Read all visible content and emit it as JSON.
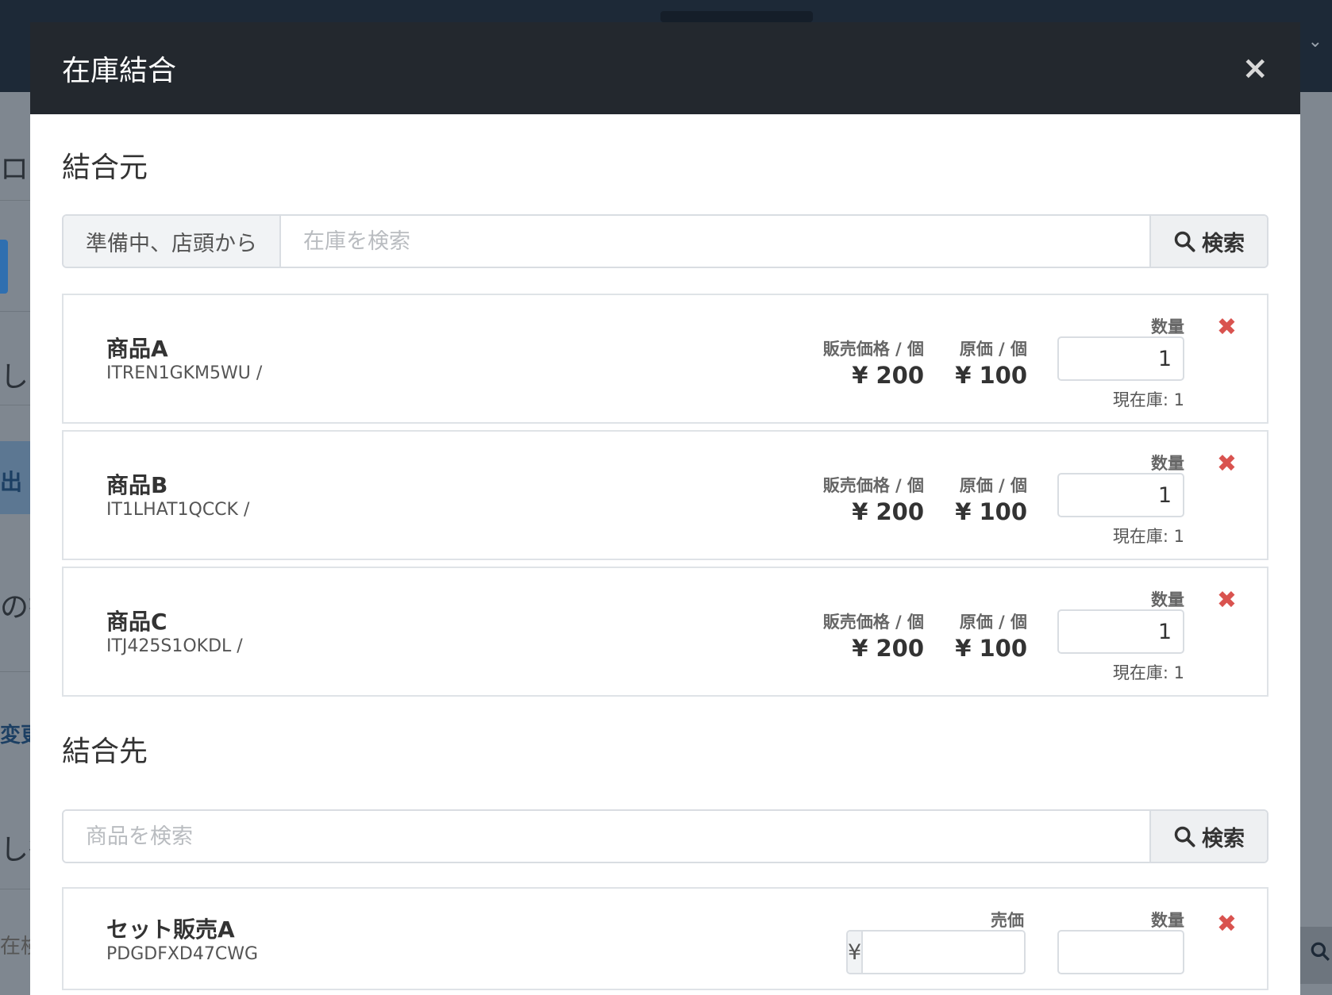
{
  "background": {
    "side_fragments": [
      "ログ",
      "し開",
      "出",
      "の操",
      "変更",
      "し待",
      "在検"
    ],
    "right_icon": "search-icon"
  },
  "modal": {
    "title": "在庫結合",
    "close_glyph": "×"
  },
  "source": {
    "section_title": "結合元",
    "filter_label": "準備中、店頭から",
    "search_placeholder": "在庫を検索",
    "search_button": "検索",
    "items": [
      {
        "name": "商品A",
        "code": "ITREN1GKM5WU /",
        "sale_label": "販売価格 / 個",
        "sale_price": "¥ 200",
        "cost_label": "原価 / 個",
        "cost_price": "¥ 100",
        "qty_label": "数量",
        "qty": "1",
        "stock": "現在庫: 1"
      },
      {
        "name": "商品B",
        "code": "IT1LHAT1QCCK /",
        "sale_label": "販売価格 / 個",
        "sale_price": "¥ 200",
        "cost_label": "原価 / 個",
        "cost_price": "¥ 100",
        "qty_label": "数量",
        "qty": "1",
        "stock": "現在庫: 1"
      },
      {
        "name": "商品C",
        "code": "ITJ425S1OKDL /",
        "sale_label": "販売価格 / 個",
        "sale_price": "¥ 200",
        "cost_label": "原価 / 個",
        "cost_price": "¥ 100",
        "qty_label": "数量",
        "qty": "1",
        "stock": "現在庫: 1"
      }
    ]
  },
  "destination": {
    "section_title": "結合先",
    "search_placeholder": "商品を検索",
    "search_button": "検索",
    "item": {
      "name": "セット販売A",
      "code": "PDGDFXD47CWG",
      "sell_label": "売価",
      "currency": "¥",
      "sell_value": "",
      "qty_label": "数量",
      "qty": ""
    }
  },
  "colors": {
    "header_bg": "#23282e",
    "remove_red": "#d9534f",
    "border": "#d9dde2"
  },
  "icons": {
    "remove": "✖",
    "search": "search-icon"
  }
}
